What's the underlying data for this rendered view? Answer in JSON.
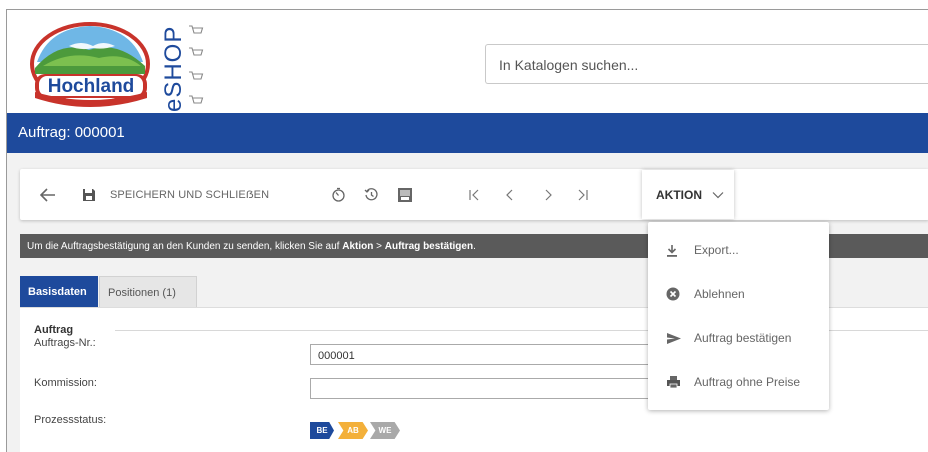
{
  "brand": {
    "logo_text": "Hochland",
    "eshop_text": "eSHOP"
  },
  "search": {
    "placeholder": "In Katalogen suchen..."
  },
  "header": {
    "title": "Auftrag: 000001"
  },
  "toolbar": {
    "save_label": "SPEICHERN UND SCHLIEẞEN",
    "action_label": "AKTION"
  },
  "info": {
    "prefix": "Um die Auftragsbestätigung an den Kunden zu senden, klicken Sie auf ",
    "bold1": "Aktion",
    "separator": " > ",
    "bold2": "Auftrag bestätigen",
    "suffix": "."
  },
  "tabs": [
    {
      "label": "Basisdaten",
      "active": true
    },
    {
      "label": "Positionen (1)",
      "active": false
    }
  ],
  "form": {
    "section_title": "Auftrag",
    "order_no_label": "Auftrags-Nr.:",
    "order_no_value": "000001",
    "commission_label": "Kommission:",
    "commission_value": "",
    "status_label": "Prozessstatus:",
    "status_steps": [
      {
        "label": "BE",
        "color": "#1e4a9c"
      },
      {
        "label": "AB",
        "color": "#f3b03a"
      },
      {
        "label": "WE",
        "color": "#a9a9a9"
      }
    ]
  },
  "action_menu": {
    "items": [
      {
        "label": "Export...",
        "icon": "download-icon"
      },
      {
        "label": "Ablehnen",
        "icon": "reject-circle-icon"
      },
      {
        "label": "Auftrag bestätigen",
        "icon": "send-icon"
      },
      {
        "label": "Auftrag ohne Preise",
        "icon": "print-icon"
      }
    ]
  },
  "colors": {
    "brand_blue": "#1e4a9c",
    "logo_red": "#c8332b",
    "info_bar": "#5a5a5a"
  }
}
